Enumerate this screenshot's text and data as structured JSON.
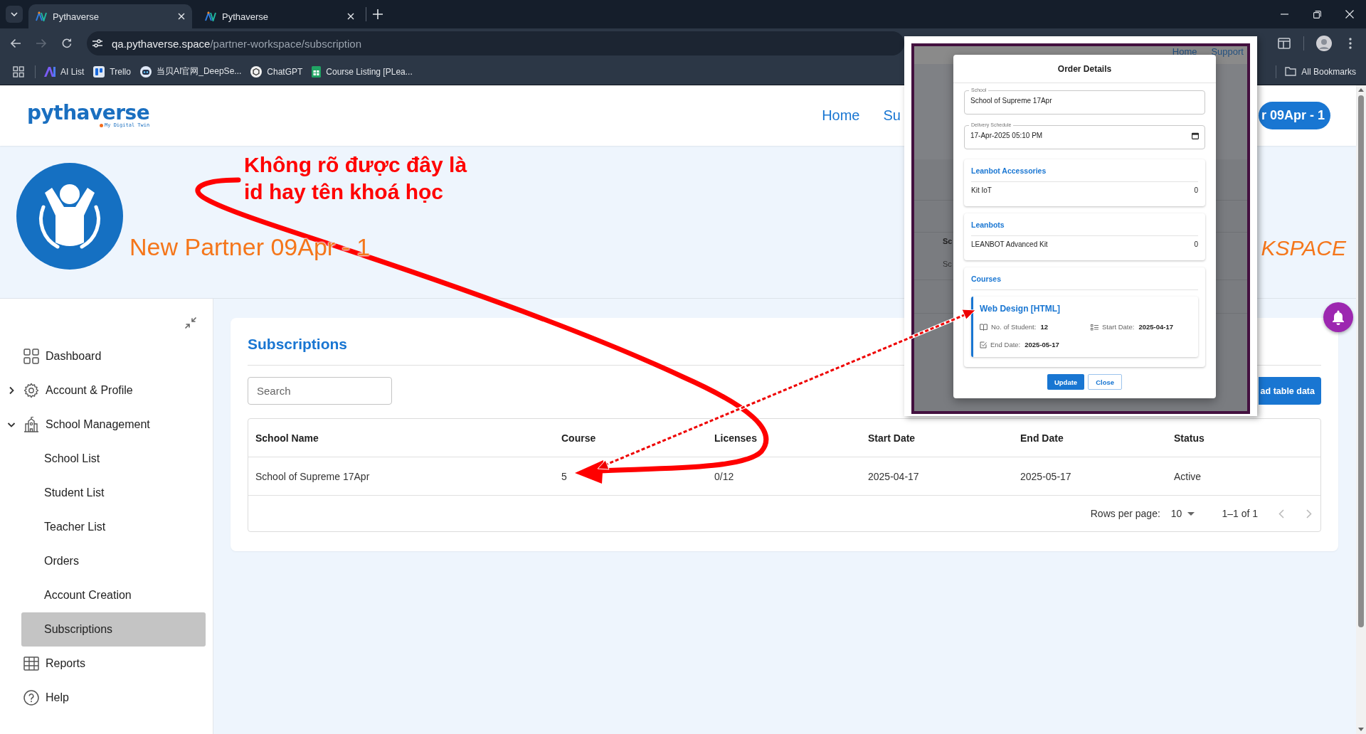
{
  "browser": {
    "tabs": [
      {
        "title": "Pythaverse",
        "selected": true
      },
      {
        "title": "Pythaverse",
        "selected": false
      }
    ],
    "nav_buttons": [
      {
        "kind": "back",
        "disabled": false
      },
      {
        "kind": "forward",
        "disabled": true
      },
      {
        "kind": "reload",
        "disabled": false
      }
    ],
    "url": {
      "host": "qa.pythaverse.space",
      "path": "/partner-workspace/subscription"
    },
    "bookmarks": [
      {
        "kind": "ai",
        "label": "AI List"
      },
      {
        "kind": "board",
        "label": "Trello"
      },
      {
        "kind": "robot",
        "label": "当贝AI官网_DeepSe..."
      },
      {
        "kind": "chat",
        "label": "ChatGPT"
      },
      {
        "kind": "sheet",
        "label": "Course Listing [PLea..."
      }
    ],
    "all_bookmarks": "All Bookmarks"
  },
  "header": {
    "logo": {
      "name": "pythaverse",
      "tagline": "My Digital Twin"
    },
    "nav": [
      "Home",
      "Su"
    ],
    "account_button": "r 09Apr - 1"
  },
  "banner": {
    "partner_name": "New Partner 09Apr - 1",
    "workspace_label": "KSPACE"
  },
  "sidebar": {
    "items": [
      {
        "kind": "dashboard",
        "label": "Dashboard",
        "selected": false
      },
      {
        "kind": "account",
        "label": "Account & Profile",
        "expanded": false,
        "selected": false
      },
      {
        "kind": "school",
        "label": "School Management",
        "expanded": true,
        "selected": false,
        "children": [
          {
            "label": "School List",
            "selected": false
          },
          {
            "label": "Student List",
            "selected": false
          },
          {
            "label": "Teacher List",
            "selected": false
          },
          {
            "label": "Orders",
            "selected": false
          },
          {
            "label": "Account Creation",
            "selected": false
          },
          {
            "label": "Subscriptions",
            "selected": true
          }
        ]
      },
      {
        "kind": "reports",
        "label": "Reports",
        "selected": false
      },
      {
        "kind": "help",
        "label": "Help",
        "selected": false
      }
    ]
  },
  "subscriptions": {
    "title": "Subscriptions",
    "search": {
      "placeholder": "Search"
    },
    "download_button": "ad table data",
    "table": {
      "columns": [
        "School Name",
        "Course",
        "Licenses",
        "Start Date",
        "End Date",
        "Status"
      ],
      "rows": [
        [
          "School of Supreme 17Apr",
          "5",
          "0/12",
          "2025-04-17",
          "2025-05-17",
          "Active"
        ]
      ]
    },
    "pagination": {
      "rows_per_page_label": "Rows per page:",
      "rows_per_page": "10",
      "range": "1–1 of 1",
      "previous_disabled": true,
      "next_disabled": true
    }
  },
  "inset": {
    "nav": [
      "Home",
      "Support"
    ],
    "table_fragments": [
      {
        "kind": "header",
        "text": "Sc"
      },
      {
        "kind": "cell",
        "text": "Sc"
      }
    ],
    "modal": {
      "title": "Order Details",
      "fields": [
        {
          "kind": "text",
          "label": "School",
          "value": "School of Supreme 17Apr"
        },
        {
          "kind": "date",
          "label": "Delivery Schedule",
          "value": "17-Apr-2025 05:10 PM"
        }
      ],
      "sections": [
        {
          "kind": "items",
          "title": "Leanbot Accessories",
          "items": [
            {
              "name": "Kit IoT",
              "quantity": "0"
            }
          ]
        },
        {
          "kind": "items",
          "title": "Leanbots",
          "items": [
            {
              "name": "LEANBOT Advanced Kit",
              "quantity": "0"
            }
          ]
        },
        {
          "kind": "courses",
          "title": "Courses",
          "courses": [
            {
              "name": "Web Design [HTML]",
              "stats": [
                {
                  "kind": "students",
                  "label": "No. of Student:",
                  "value": "12"
                },
                {
                  "kind": "start",
                  "label": "Start Date:",
                  "value": "2025-04-17"
                },
                {
                  "kind": "end",
                  "label": "End Date:",
                  "value": "2025-05-17"
                }
              ]
            }
          ]
        }
      ],
      "buttons": [
        {
          "kind": "primary",
          "label": "Update"
        },
        {
          "kind": "secondary",
          "label": "Close"
        }
      ]
    }
  },
  "annotation": {
    "note": "Không rõ được đây là\nid hay tên khoá học"
  }
}
